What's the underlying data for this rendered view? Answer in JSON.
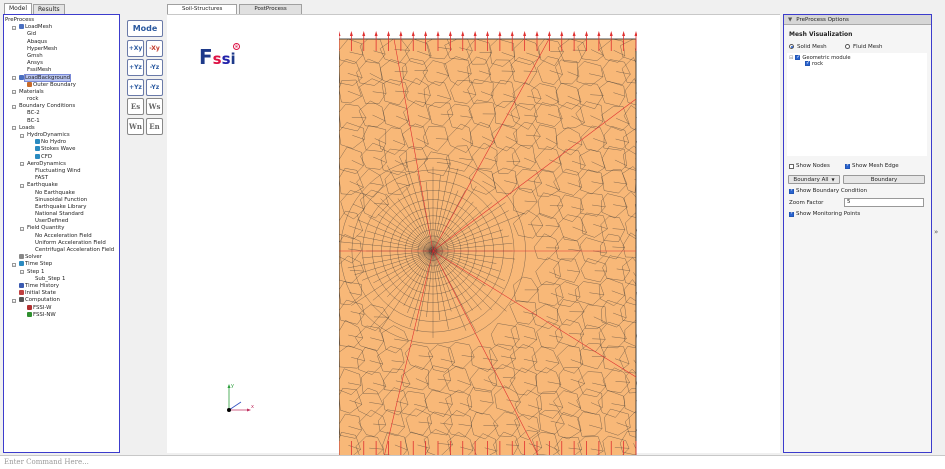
{
  "left_tabs": [
    "Model",
    "Results"
  ],
  "tree": [
    {
      "label": "PreProcess",
      "level": 0,
      "icon": ""
    },
    {
      "label": "LoadMesh",
      "level": 1,
      "icon": "grid",
      "toggle": "-"
    },
    {
      "label": "Gid",
      "level": 2,
      "icon": ""
    },
    {
      "label": "Abaqus",
      "level": 2,
      "icon": ""
    },
    {
      "label": "HyperMesh",
      "level": 2,
      "icon": ""
    },
    {
      "label": "Gmsh",
      "level": 2,
      "icon": ""
    },
    {
      "label": "Ansys",
      "level": 2,
      "icon": ""
    },
    {
      "label": "FssiMesh",
      "level": 2,
      "icon": ""
    },
    {
      "label": "LoadBackground",
      "level": 1,
      "icon": "bg",
      "toggle": "-",
      "selected": true
    },
    {
      "label": "Outer Boundary",
      "level": 2,
      "icon": "boundary"
    },
    {
      "label": "Materials",
      "level": 1,
      "icon": "",
      "toggle": "-"
    },
    {
      "label": "rock",
      "level": 2,
      "icon": ""
    },
    {
      "label": "Boundary Conditions",
      "level": 1,
      "icon": "",
      "toggle": "-"
    },
    {
      "label": "BC-2",
      "level": 2,
      "icon": ""
    },
    {
      "label": "BC-1",
      "level": 2,
      "icon": ""
    },
    {
      "label": "Loads",
      "level": 1,
      "icon": "",
      "toggle": "-"
    },
    {
      "label": "HydroDynamics",
      "level": 2,
      "icon": "",
      "toggle": "-"
    },
    {
      "label": "No Hydro",
      "level": 3,
      "icon": "cube"
    },
    {
      "label": "Stokes Wave",
      "level": 3,
      "icon": "wave"
    },
    {
      "label": "CFD",
      "level": 3,
      "icon": "cfd"
    },
    {
      "label": "AeroDynamics",
      "level": 2,
      "icon": "",
      "toggle": "-"
    },
    {
      "label": "Fluctuating Wind",
      "level": 3,
      "icon": ""
    },
    {
      "label": "FAST",
      "level": 3,
      "icon": ""
    },
    {
      "label": "Earthquake",
      "level": 2,
      "icon": "",
      "toggle": "-"
    },
    {
      "label": "No Earthquake",
      "level": 3,
      "icon": ""
    },
    {
      "label": "Sinusoidal Function",
      "level": 3,
      "icon": ""
    },
    {
      "label": "Earthquake Library",
      "level": 3,
      "icon": ""
    },
    {
      "label": "National Standard",
      "level": 3,
      "icon": ""
    },
    {
      "label": "UserDefined",
      "level": 3,
      "icon": ""
    },
    {
      "label": "Field Quantity",
      "level": 2,
      "icon": "",
      "toggle": "-"
    },
    {
      "label": "No Acceleration Field",
      "level": 3,
      "icon": ""
    },
    {
      "label": "Uniform Acceleration Field",
      "level": 3,
      "icon": ""
    },
    {
      "label": "Centrifugal Acceleration Field",
      "level": 3,
      "icon": ""
    },
    {
      "label": "Solver",
      "level": 1,
      "icon": "solver"
    },
    {
      "label": "Time Step",
      "level": 1,
      "icon": "clock",
      "toggle": "-"
    },
    {
      "label": "Step 1",
      "level": 2,
      "icon": "",
      "toggle": "-"
    },
    {
      "label": "Sub_Step 1",
      "level": 3,
      "icon": ""
    },
    {
      "label": "Time History",
      "level": 1,
      "icon": "history"
    },
    {
      "label": "Initial State",
      "level": 1,
      "icon": "state"
    },
    {
      "label": "Computation",
      "level": 1,
      "icon": "comp",
      "toggle": "-"
    },
    {
      "label": "FSSI-W",
      "level": 2,
      "icon": "fw"
    },
    {
      "label": "FSSI-NW",
      "level": 2,
      "icon": "fnw"
    }
  ],
  "toolbar": {
    "mode_label": "Mode",
    "buttons": [
      [
        "+Xy",
        "-Xy"
      ],
      [
        "+Yz",
        "-Yz"
      ],
      [
        "+Yz",
        "-Yz"
      ],
      [
        "Es",
        "Ws"
      ],
      [
        "Wn",
        "En"
      ]
    ]
  },
  "center_tabs": [
    "Soil-Structures",
    "PostProcess"
  ],
  "logo": {
    "letters": [
      "F",
      "s",
      "s",
      "i"
    ],
    "mark": "®"
  },
  "axes": {
    "y": "y",
    "x": "x"
  },
  "right_panel": {
    "header": "PreProcess Options",
    "section_title": "Mesh Visualization",
    "radio_solid": "Solid Mesh",
    "radio_fluid": "Fluid Mesh",
    "geo_module": "Geometric module",
    "geo_item": "rock",
    "show_nodes": "Show Nodes",
    "show_mesh_edge": "Show Mesh Edge",
    "boundary_select": "Boundary All",
    "boundary_button": "Boundary",
    "show_bc": "Show Boundary Condition",
    "zoom_label": "Zoom Factor",
    "zoom_value": "5",
    "show_monitor": "Show Monitoring Points"
  },
  "command_placeholder": "Enter Command Here...",
  "colors": {
    "mesh_fill": "#f8b878",
    "mesh_line": "#333333",
    "bc_arrow": "#e03030",
    "highlight": "#3c3ccc"
  }
}
